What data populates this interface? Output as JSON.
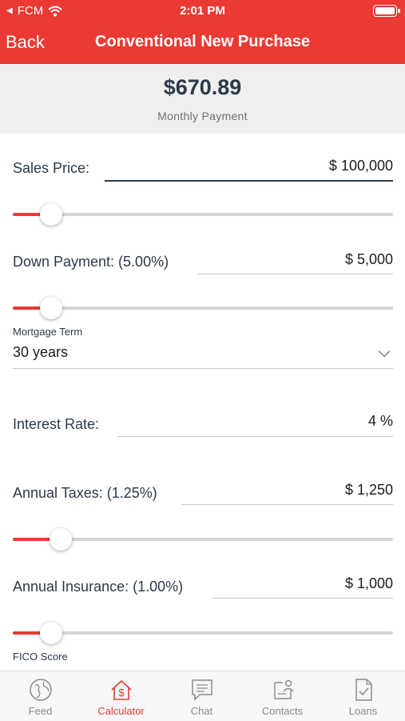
{
  "status": {
    "carrier": "FCM",
    "time": "2:01 PM"
  },
  "header": {
    "back_label": "Back",
    "title": "Conventional New Purchase"
  },
  "summary": {
    "amount": "$670.89",
    "label": "Monthly Payment"
  },
  "fields": {
    "sales_price": {
      "label": "Sales Price:",
      "value": "$ 100,000",
      "slider_level": 0.1
    },
    "down_payment": {
      "label": "Down Payment: (5.00%)",
      "value": "$ 5,000",
      "slider_level": 0.1
    },
    "mortgage_term": {
      "label": "Mortgage Term",
      "value": "30 years"
    },
    "interest_rate": {
      "label": "Interest Rate:",
      "value": "4 %"
    },
    "annual_taxes": {
      "label": "Annual Taxes: (1.25%)",
      "value": "$ 1,250",
      "slider_level": 0.125
    },
    "annual_insurance": {
      "label": "Annual Insurance: (1.00%)",
      "value": "$ 1,000",
      "slider_level": 0.1
    },
    "fico_score": {
      "label": "FICO Score"
    }
  },
  "tabs": [
    {
      "label": "Feed",
      "icon": "globe-icon",
      "active": false
    },
    {
      "label": "Calculator",
      "icon": "house-dollar-icon",
      "active": true
    },
    {
      "label": "Chat",
      "icon": "chat-icon",
      "active": false
    },
    {
      "label": "Contacts",
      "icon": "contacts-icon",
      "active": false
    },
    {
      "label": "Loans",
      "icon": "document-check-icon",
      "active": false
    }
  ],
  "colors": {
    "accent": "#ea3a33",
    "text": "#2b3a4a",
    "summary_bg": "#efefef"
  }
}
